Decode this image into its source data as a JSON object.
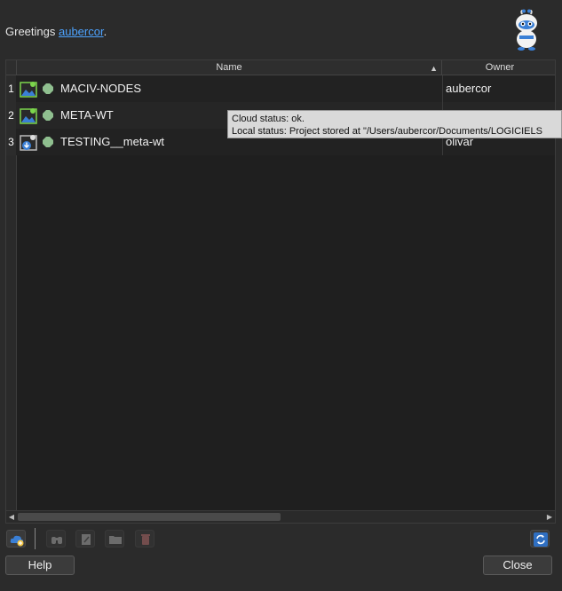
{
  "header": {
    "greeting_prefix": "Greetings ",
    "username": "aubercor",
    "greeting_suffix": "."
  },
  "table": {
    "columns": {
      "name": "Name",
      "owner": "Owner"
    },
    "rows": [
      {
        "num": "1",
        "name": "MACIV-NODES",
        "owner": "aubercor"
      },
      {
        "num": "2",
        "name": "META-WT",
        "owner": ""
      },
      {
        "num": "3",
        "name": "TESTING__meta-wt",
        "owner": "olivar"
      }
    ]
  },
  "tooltip": {
    "line1": "Cloud status: ok.",
    "line2": "Local status: Project stored at \"/Users/aubercor/Documents/LOGICIELS"
  },
  "buttons": {
    "help": "Help",
    "close": "Close"
  },
  "colors": {
    "accent": "#4da3ff",
    "status_ok": "#8fbf8f",
    "background": "#2b2b2b"
  }
}
